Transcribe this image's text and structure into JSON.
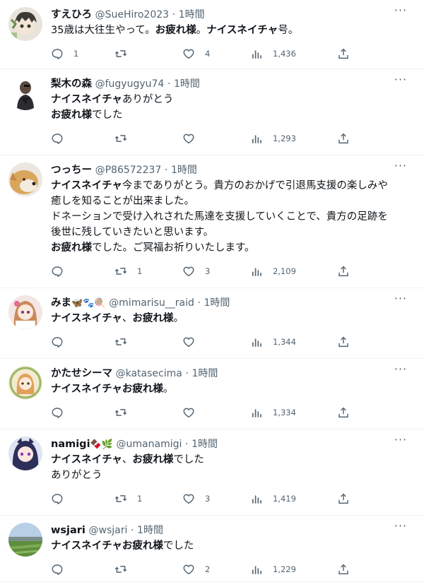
{
  "tweets": [
    {
      "name": "すえひろ",
      "handle": "@SueHiro2023",
      "time": "1時間",
      "lines": [
        [
          {
            "t": "35歳は大往生やって。",
            "b": false
          },
          {
            "t": "お疲れ様",
            "b": true
          },
          {
            "t": "。",
            "b": false
          },
          {
            "t": "ナイスネイチャ",
            "b": true
          },
          {
            "t": "号。",
            "b": false
          }
        ]
      ],
      "replies": "1",
      "retweets": "",
      "likes": "4",
      "views": "1,436"
    },
    {
      "name": "梨木の森",
      "handle": "@fugyugyu74",
      "time": "1時間",
      "lines": [
        [
          {
            "t": "ナイスネイチャ",
            "b": true
          },
          {
            "t": "ありがとう",
            "b": false
          }
        ],
        [
          {
            "t": "お疲れ様",
            "b": true
          },
          {
            "t": "でした",
            "b": false
          }
        ]
      ],
      "replies": "",
      "retweets": "",
      "likes": "",
      "views": "1,293"
    },
    {
      "name": "つっちー",
      "handle": "@P86572237",
      "time": "1時間",
      "lines": [
        [
          {
            "t": "ナイスネイチャ",
            "b": true
          },
          {
            "t": "今までありがとう。貴方のおかげで引退馬支援の楽しみや",
            "b": false
          }
        ],
        [
          {
            "t": "癒しを知ることが出来ました。",
            "b": false
          }
        ],
        [
          {
            "t": "ドネーションで受け入れされた馬達を支援していくことで、貴方の足跡を",
            "b": false
          }
        ],
        [
          {
            "t": "後世に残していきたいと思います。",
            "b": false
          }
        ],
        [
          {
            "t": "お疲れ様",
            "b": true
          },
          {
            "t": "でした。ご冥福お祈りいたします。",
            "b": false
          }
        ]
      ],
      "replies": "",
      "retweets": "1",
      "likes": "3",
      "views": "2,109"
    },
    {
      "name": "みま",
      "name_emoji": "🦋🐾🍭",
      "handle": "@mimarisu__raid",
      "time": "1時間",
      "lines": [
        [
          {
            "t": "ナイスネイチャ",
            "b": true
          },
          {
            "t": "、",
            "b": false
          },
          {
            "t": "お疲れ様",
            "b": true
          },
          {
            "t": "。",
            "b": false
          }
        ]
      ],
      "replies": "",
      "retweets": "",
      "likes": "",
      "views": "1,344"
    },
    {
      "name": "かたせシーマ",
      "handle": "@katasecima",
      "time": "1時間",
      "lines": [
        [
          {
            "t": "ナイスネイチャ",
            "b": true
          },
          {
            "t": "お疲れ様",
            "b": true
          },
          {
            "t": "。",
            "b": false
          }
        ]
      ],
      "replies": "",
      "retweets": "",
      "likes": "",
      "views": "1,334"
    },
    {
      "name": "namigi",
      "name_emoji": "🍫🌿",
      "handle": "@umanamigi",
      "time": "1時間",
      "lines": [
        [
          {
            "t": "ナイスネイチャ",
            "b": true
          },
          {
            "t": "、",
            "b": false
          },
          {
            "t": "お疲れ様",
            "b": true
          },
          {
            "t": "でした",
            "b": false
          }
        ],
        [
          {
            "t": "ありがとう",
            "b": false
          }
        ]
      ],
      "replies": "",
      "retweets": "1",
      "likes": "3",
      "views": "1,419"
    },
    {
      "name": "wsjari",
      "handle": "@wsjari",
      "time": "1時間",
      "lines": [
        [
          {
            "t": "ナイスネイチャ",
            "b": true
          },
          {
            "t": "お疲れ様",
            "b": true
          },
          {
            "t": "でした",
            "b": false
          }
        ]
      ],
      "replies": "",
      "retweets": "",
      "likes": "2",
      "views": "1,229"
    }
  ],
  "separator": "·",
  "more_glyph": "···",
  "icons": {
    "reply": "reply-icon",
    "retweet": "retweet-icon",
    "like": "heart-icon",
    "views": "views-icon",
    "share": "share-icon",
    "more": "more-icon"
  },
  "colors": {
    "text": "#0f1419",
    "secondary": "#536471",
    "divider": "#eff3f4"
  }
}
